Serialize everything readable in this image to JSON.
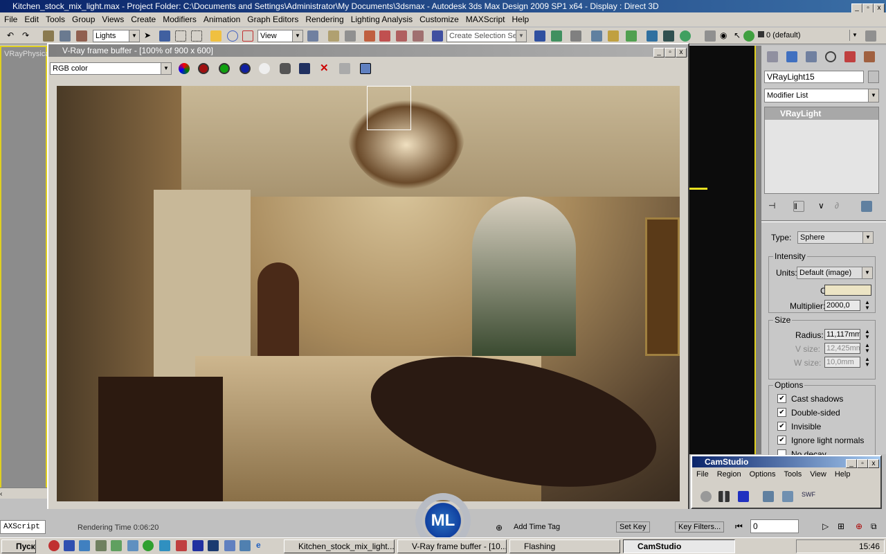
{
  "app": {
    "title": "Kitchen_stock_mix_light.max    - Project Folder: C:\\Documents and Settings\\Administrator\\My Documents\\3dsmax    - Autodesk 3ds Max Design 2009 SP1  x64     - Display : Direct 3D"
  },
  "menu": [
    "File",
    "Edit",
    "Tools",
    "Group",
    "Views",
    "Create",
    "Modifiers",
    "Animation",
    "Graph Editors",
    "Rendering",
    "Lighting Analysis",
    "Customize",
    "MAXScript",
    "Help"
  ],
  "toolbar": {
    "filter": "Lights",
    "ref_coord": "View",
    "selection_set": "Create Selection Set",
    "layer": "0 (default)"
  },
  "viewport": {
    "label": "VRayPhysica..."
  },
  "vfb": {
    "title": "V-Ray frame buffer - [100% of 900 x 600]",
    "channel": "RGB color"
  },
  "panel": {
    "object_name": "VRayLight15",
    "modifier_list": "Modifier List",
    "stack_item": "VRayLight",
    "type_label": "Type:",
    "type": "Sphere",
    "intensity": "Intensity",
    "units_label": "Units:",
    "units": "Default (image)",
    "color_label": "Color:",
    "light_color": "#ece4c4",
    "multiplier_label": "Multiplier:",
    "multiplier": "2000,0",
    "size": "Size",
    "radius_label": "Radius:",
    "radius": "11,117mm",
    "v_label": "V size:",
    "v_size": "12,425mm",
    "w_label": "W size:",
    "w_size": "10,0mm",
    "options": "Options",
    "checks": [
      {
        "label": "Cast shadows",
        "checked": true
      },
      {
        "label": "Double-sided",
        "checked": true
      },
      {
        "label": "Invisible",
        "checked": true
      },
      {
        "label": "Ignore light normals",
        "checked": true
      },
      {
        "label": "No decay",
        "checked": false
      }
    ]
  },
  "status": {
    "script": "AXScript",
    "render_time": "Rendering Time  0:06:20",
    "add_time_tag": "Add Time Tag",
    "set_key": "Set Key",
    "key_filters": "Key Filters...",
    "frame": "0"
  },
  "camstudio": {
    "title": "CamStudio",
    "menu": [
      "File",
      "Region",
      "Options",
      "Tools",
      "View",
      "Help"
    ]
  },
  "taskbar": {
    "start": "Пуск",
    "tasks": [
      "Kitchen_stock_mix_light....",
      "V-Ray frame buffer - [10...",
      "Flashing",
      "CamStudio"
    ],
    "clock": "15:46"
  }
}
